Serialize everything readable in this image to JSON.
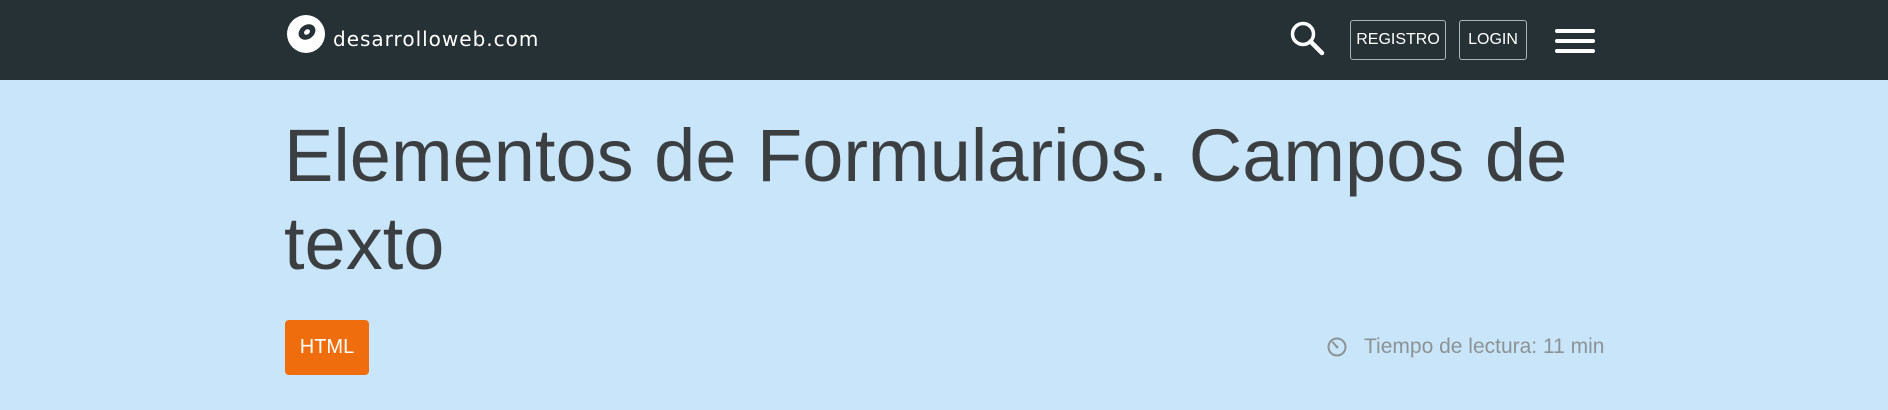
{
  "header": {
    "logo_text": "desarrolloweb.com",
    "registro_label": "REGISTRO",
    "login_label": "LOGIN",
    "icons": {
      "logo": "disc-logo-icon",
      "search": "search-icon",
      "menu": "hamburger-menu-icon"
    }
  },
  "article": {
    "title": "Elementos de Formularios. Campos de texto",
    "tag_label": "HTML",
    "reading_time": "Tiempo de lectura: 11 min",
    "reading_icon": "clock-icon"
  },
  "colors": {
    "header_bg": "#253134",
    "page_bg": "#c9e5f9",
    "title_text": "#3b3f42",
    "tag_bg": "#ef6d0c",
    "muted_text": "#8c9396"
  }
}
